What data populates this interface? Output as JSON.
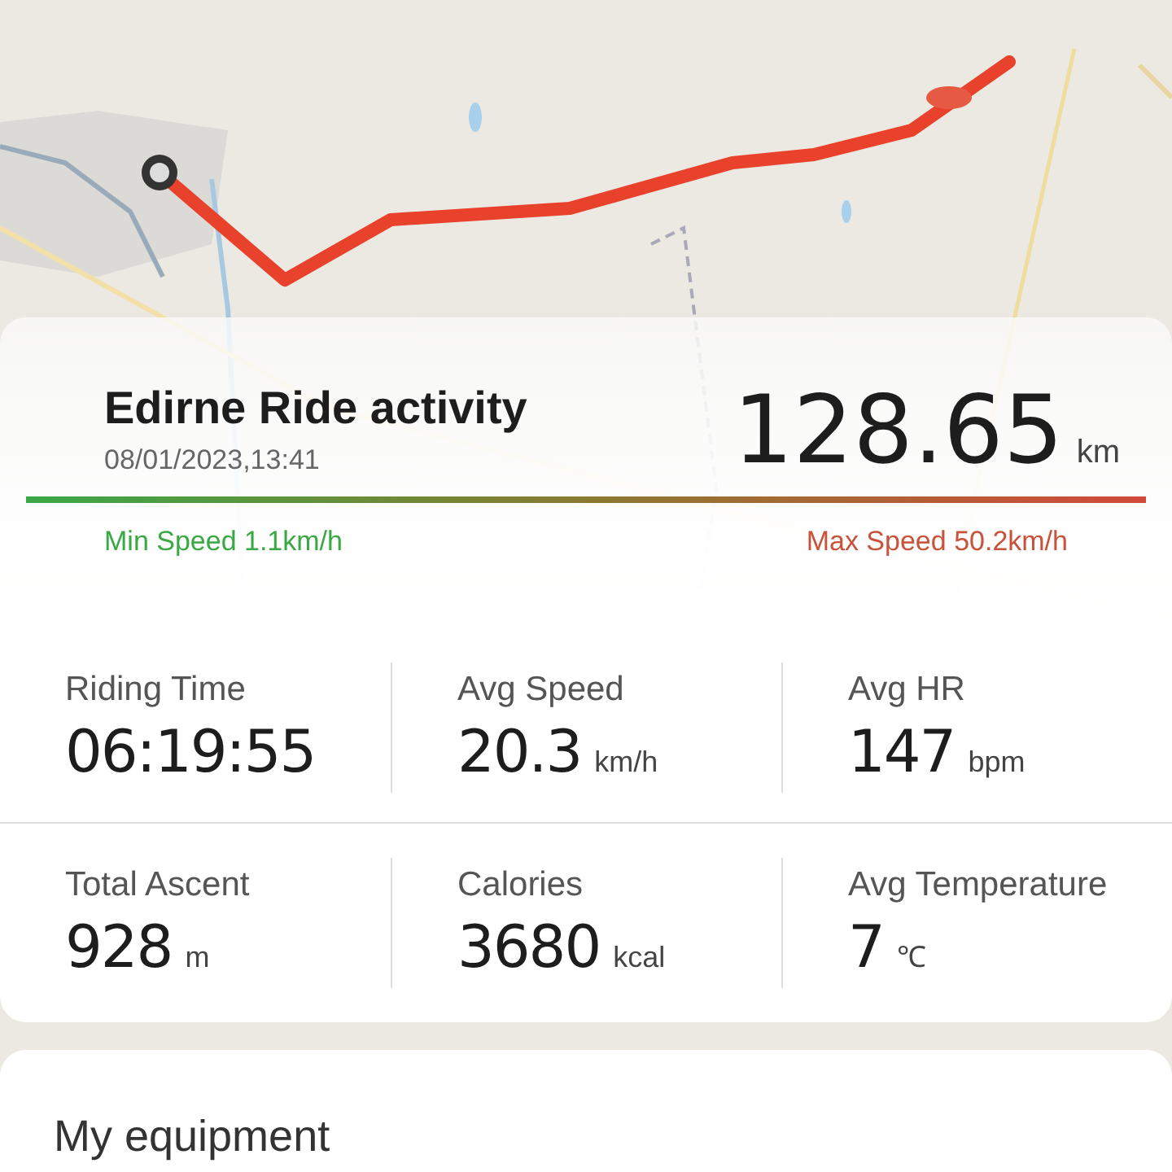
{
  "activity": {
    "title": "Edirne Ride activity",
    "datetime": "08/01/2023,13:41",
    "distance": "128.65",
    "distance_unit": "km",
    "min_speed": "Min Speed 1.1km/h",
    "max_speed": "Max Speed 50.2km/h"
  },
  "stats": [
    [
      {
        "label": "Riding Time",
        "value": "06:19:55"
      },
      {
        "label": "Avg Speed",
        "value": "20.3",
        "unit": "km/h"
      },
      {
        "label": "Avg HR",
        "value": "147",
        "unit": "bpm"
      }
    ],
    [
      {
        "label": "Total Ascent",
        "value": "928",
        "unit": "m"
      },
      {
        "label": "Calories",
        "value": "3680",
        "unit": "kcal"
      },
      {
        "label": "Avg Temperature",
        "value": "7",
        "unit": "℃"
      }
    ]
  ],
  "equipment": {
    "title": "My equipment"
  }
}
